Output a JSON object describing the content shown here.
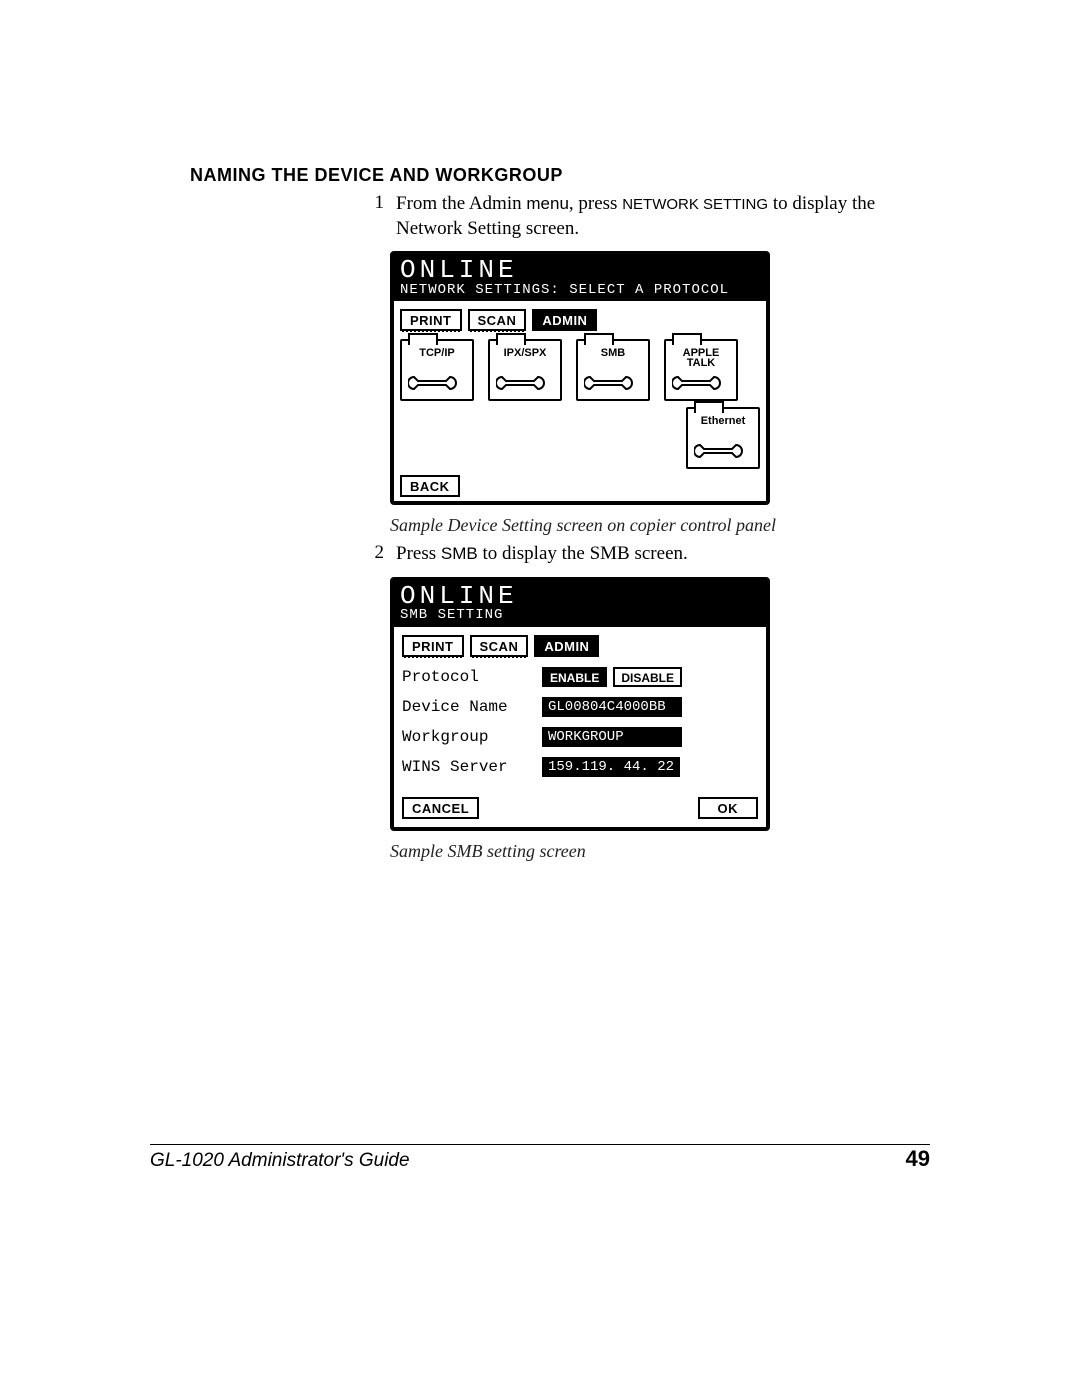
{
  "heading": "NAMING THE DEVICE AND WORKGROUP",
  "steps": {
    "s1": {
      "num": "1",
      "pre": "From the Admin ",
      "menu": "menu",
      "mid": ", press ",
      "smallcaps": "NETWORK SETTING",
      "post": " to display the Network Setting screen."
    },
    "s2": {
      "num": "2",
      "pre": "Press ",
      "sans": "SMB",
      "post": " to display the SMB screen."
    }
  },
  "panel1": {
    "title": "ONLINE",
    "sub": "NETWORK SETTINGS: SELECT A PROTOCOL",
    "tabs": {
      "print": "PRINT",
      "scan": "SCAN",
      "admin": "ADMIN"
    },
    "folders": {
      "tcpip": "TCP/IP",
      "ipxspx": "IPX/SPX",
      "smb": "SMB",
      "apple": "APPLE\nTALK",
      "ethernet": "Ethernet"
    },
    "back": "BACK"
  },
  "caption1": "Sample Device Setting screen on copier control panel",
  "panel2": {
    "title": "ONLINE",
    "sub": "SMB SETTING",
    "tabs": {
      "print": "PRINT",
      "scan": "SCAN",
      "admin": "ADMIN"
    },
    "rows": {
      "protocol": {
        "label": "Protocol",
        "enable": "ENABLE",
        "disable": "DISABLE"
      },
      "device": {
        "label": "Device Name",
        "value": "GL00804C4000BB"
      },
      "workgroup": {
        "label": "Workgroup",
        "value": "WORKGROUP"
      },
      "wins": {
        "label": "WINS Server",
        "value": "159.119. 44. 22"
      }
    },
    "cancel": "CANCEL",
    "ok": "OK"
  },
  "caption2": "Sample SMB setting screen",
  "footer": {
    "title": "GL-1020 Administrator's Guide",
    "page": "49"
  }
}
